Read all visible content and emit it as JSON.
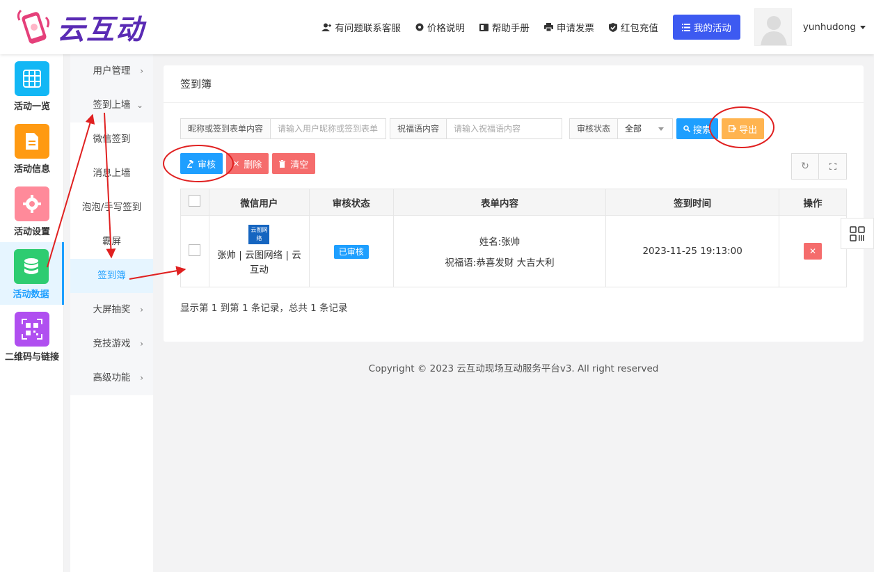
{
  "brand": {
    "name": "云互动"
  },
  "topnav": {
    "support": "有问题联系客服",
    "pricing": "价格说明",
    "help": "帮助手册",
    "invoice": "申请发票",
    "recharge": "红包充值",
    "my_activity": "我的活动",
    "username": "yunhudong"
  },
  "sidebar": [
    {
      "label": "活动一览",
      "icon": "grid-icon",
      "color": "#12b7f5"
    },
    {
      "label": "活动信息",
      "icon": "document-icon",
      "color": "#ff9a12"
    },
    {
      "label": "活动设置",
      "icon": "gear-icon",
      "color": "#ff8a9a"
    },
    {
      "label": "活动数据",
      "icon": "database-icon",
      "color": "#2ecc71"
    },
    {
      "label": "二维码与链接",
      "icon": "qrcode-icon",
      "color": "#b04ff0"
    }
  ],
  "submenu": [
    {
      "label": "用户管理"
    },
    {
      "label": "签到上墙"
    },
    {
      "label": "微信签到"
    },
    {
      "label": "消息上墙"
    },
    {
      "label": "泡泡/手写签到"
    },
    {
      "label": "霸屏"
    },
    {
      "label": "签到簿"
    },
    {
      "label": "大屏抽奖"
    },
    {
      "label": "竞技游戏"
    },
    {
      "label": "高级功能"
    }
  ],
  "panel": {
    "title": "签到簿"
  },
  "search": {
    "nick_label": "昵称或签到表单内容",
    "nick_placeholder": "请输入用户昵称或签到表单",
    "wish_label": "祝福语内容",
    "wish_placeholder": "请输入祝福语内容",
    "status_label": "审核状态",
    "status_value": "全部",
    "search_btn": "搜索",
    "export_btn": "导出"
  },
  "toolbar": {
    "approve": "审核",
    "delete": "删除",
    "clear": "清空"
  },
  "table": {
    "headers": [
      "微信用户",
      "审核状态",
      "表单内容",
      "签到时间",
      "操作"
    ],
    "rows": [
      {
        "avatar_text": "云图网络",
        "user": "张帅 | 云图网络 | 云互动",
        "status": "已审核",
        "form_name": "姓名:张帅",
        "form_wish": "祝福语:恭喜发财 大吉大利",
        "time": "2023-11-25 19:13:00"
      }
    ]
  },
  "pageinfo": "显示第 1 到第 1 条记录，总共 1 条记录",
  "footer": "Copyright © 2023 云互动现场互动服务平台v3. All right reserved"
}
